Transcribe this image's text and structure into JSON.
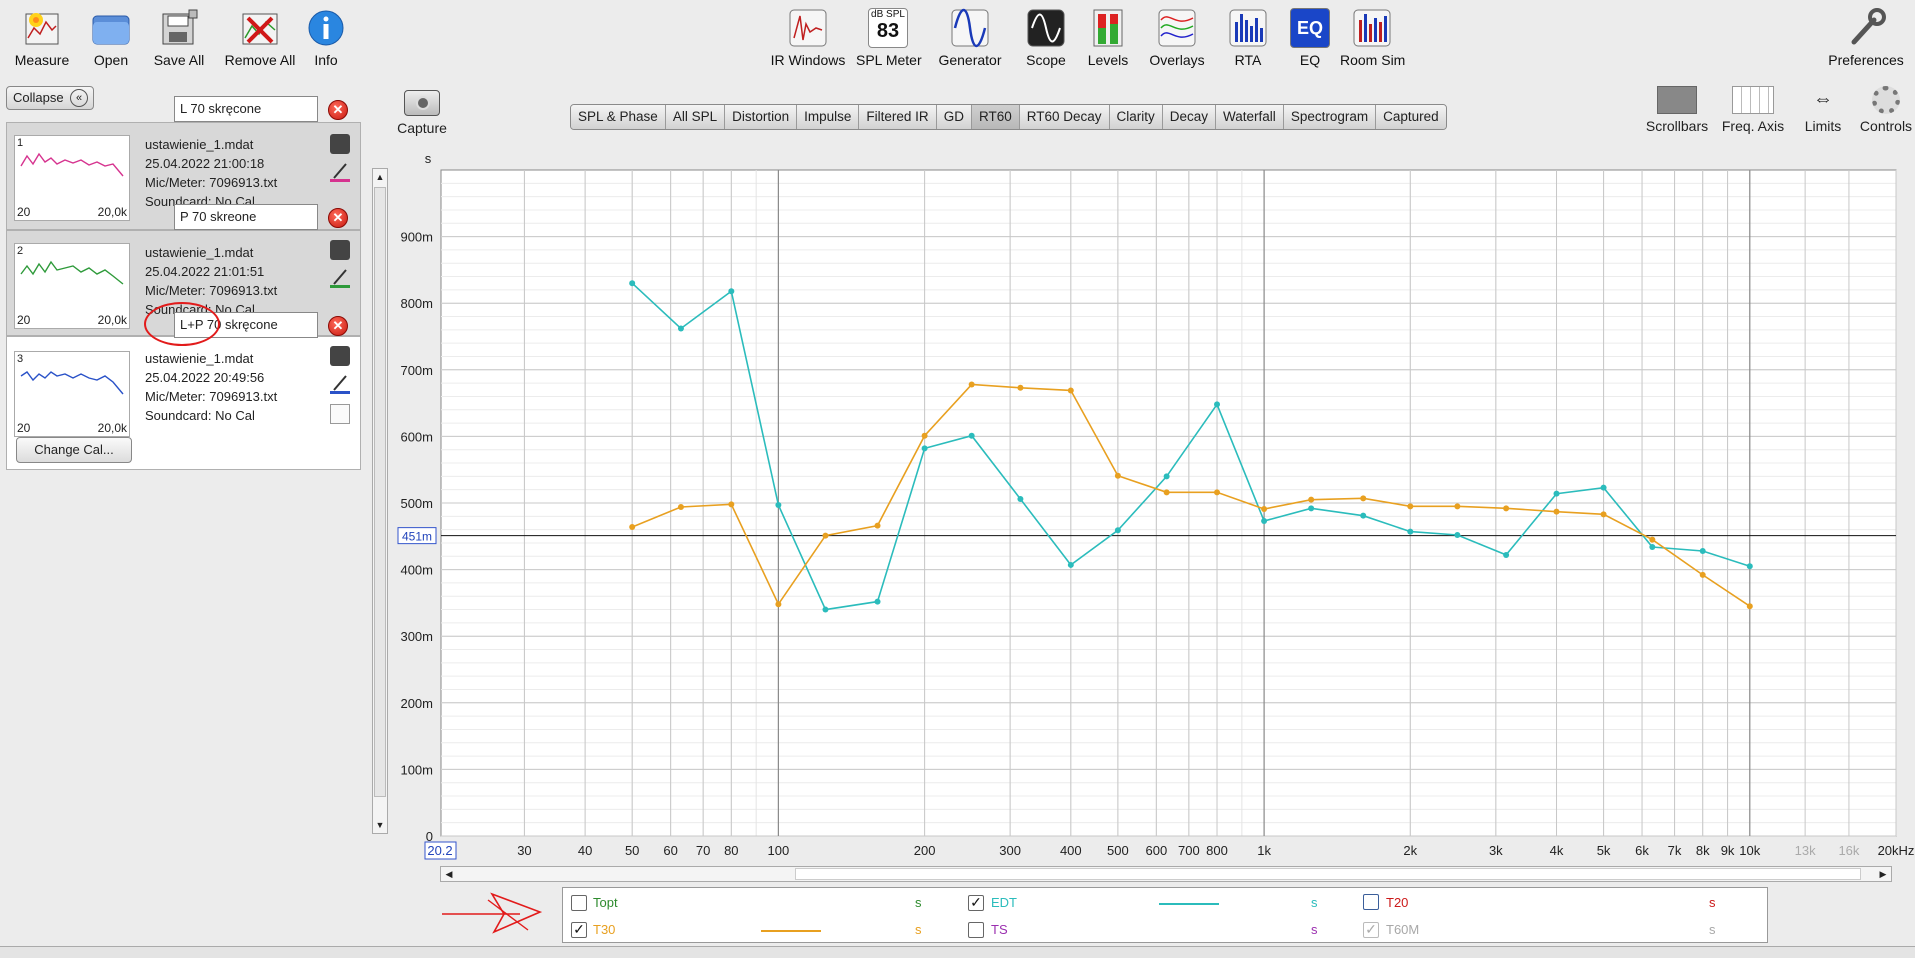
{
  "toolbar_left": [
    {
      "label": "Measure",
      "icon": "measure-icon"
    },
    {
      "label": "Open",
      "icon": "open-folder-icon"
    },
    {
      "label": "Save All",
      "icon": "save-all-icon"
    },
    {
      "label": "Remove All",
      "icon": "remove-all-icon"
    },
    {
      "label": "Info",
      "icon": "info-icon"
    }
  ],
  "toolbar_center": [
    {
      "label": "IR Windows",
      "icon": "ir-windows-icon"
    },
    {
      "label": "SPL Meter",
      "icon": "spl-meter-icon"
    },
    {
      "label": "Generator",
      "icon": "generator-icon"
    },
    {
      "label": "Scope",
      "icon": "scope-icon"
    },
    {
      "label": "Levels",
      "icon": "levels-icon"
    },
    {
      "label": "Overlays",
      "icon": "overlays-icon"
    },
    {
      "label": "RTA",
      "icon": "rta-icon"
    },
    {
      "label": "EQ",
      "icon": "eq-icon"
    },
    {
      "label": "Room Sim",
      "icon": "room-sim-icon"
    }
  ],
  "spl_meter": {
    "unit": "dB SPL",
    "value": "83"
  },
  "eq_icon_text": "EQ",
  "preferences_label": "Preferences",
  "collapse_label": "Collapse",
  "capture_label": "Capture",
  "tabs": [
    "SPL & Phase",
    "All SPL",
    "Distortion",
    "Impulse",
    "Filtered IR",
    "GD",
    "RT60",
    "RT60 Decay",
    "Clarity",
    "Decay",
    "Waterfall",
    "Spectrogram",
    "Captured"
  ],
  "active_tab": "RT60",
  "right_controls": [
    "Scrollbars",
    "Freq. Axis",
    "Limits",
    "Controls"
  ],
  "measurements": [
    {
      "num": "1",
      "name": "L 70 skręcone",
      "file": "ustawienie_1.mdat",
      "date": "25.04.2022 21:00:18",
      "mic": "Mic/Meter: 7096913.txt",
      "soundcard": "Soundcard: No Cal",
      "color": "#d6338f",
      "lo": "20",
      "hi": "20,0k"
    },
    {
      "num": "2",
      "name": "P 70 skreone",
      "file": "ustawienie_1.mdat",
      "date": "25.04.2022 21:01:51",
      "mic": "Mic/Meter: 7096913.txt",
      "soundcard": "Soundcard: No Cal",
      "color": "#2e9a3a",
      "lo": "20",
      "hi": "20,0k"
    },
    {
      "num": "3",
      "name": "L+P 70 skręcone",
      "file": "ustawienie_1.mdat",
      "date": "25.04.2022 20:49:56",
      "mic": "Mic/Meter: 7096913.txt",
      "soundcard": "Soundcard: No Cal",
      "color": "#2a52c8",
      "lo": "20",
      "hi": "20,0k"
    }
  ],
  "change_cal_label": "Change Cal...",
  "chart_data": {
    "type": "line",
    "ylabel": "s",
    "y_unit": "s",
    "ylim": [
      0,
      1.0
    ],
    "y_ticks": [
      {
        "v": 0,
        "label": "0"
      },
      {
        "v": 0.1,
        "label": "100m"
      },
      {
        "v": 0.2,
        "label": "200m"
      },
      {
        "v": 0.3,
        "label": "300m"
      },
      {
        "v": 0.4,
        "label": "400m"
      },
      {
        "v": 0.5,
        "label": "500m"
      },
      {
        "v": 0.6,
        "label": "600m"
      },
      {
        "v": 0.7,
        "label": "700m"
      },
      {
        "v": 0.8,
        "label": "800m"
      },
      {
        "v": 0.9,
        "label": "900m"
      }
    ],
    "x_scale": "log",
    "xlim": [
      20.2,
      20000
    ],
    "x_start_label": "20.2",
    "x_ticks": [
      {
        "v": 30,
        "label": "30"
      },
      {
        "v": 40,
        "label": "40"
      },
      {
        "v": 50,
        "label": "50"
      },
      {
        "v": 60,
        "label": "60"
      },
      {
        "v": 70,
        "label": "70"
      },
      {
        "v": 80,
        "label": "80"
      },
      {
        "v": 100,
        "label": "100"
      },
      {
        "v": 200,
        "label": "200"
      },
      {
        "v": 300,
        "label": "300"
      },
      {
        "v": 400,
        "label": "400"
      },
      {
        "v": 500,
        "label": "500"
      },
      {
        "v": 600,
        "label": "600"
      },
      {
        "v": 700,
        "label": "700"
      },
      {
        "v": 800,
        "label": "800"
      },
      {
        "v": 1000,
        "label": "1k"
      },
      {
        "v": 2000,
        "label": "2k"
      },
      {
        "v": 3000,
        "label": "3k"
      },
      {
        "v": 4000,
        "label": "4k"
      },
      {
        "v": 5000,
        "label": "5k"
      },
      {
        "v": 6000,
        "label": "6k"
      },
      {
        "v": 7000,
        "label": "7k"
      },
      {
        "v": 8000,
        "label": "8k"
      },
      {
        "v": 9000,
        "label": "9k"
      },
      {
        "v": 10000,
        "label": "10k"
      },
      {
        "v": 13000,
        "label": "13k",
        "dim": true
      },
      {
        "v": 16000,
        "label": "16k",
        "dim": true
      },
      {
        "v": 20000,
        "label": "20kHz"
      }
    ],
    "cursor": {
      "y": 0.451,
      "label": "451m"
    },
    "series": [
      {
        "name": "EDT",
        "color": "#2bbcbc",
        "x": [
          50,
          63,
          80,
          100,
          125,
          160,
          200,
          250,
          315,
          400,
          500,
          630,
          800,
          1000,
          1250,
          1600,
          2000,
          2500,
          3150,
          4000,
          5000,
          6300,
          8000,
          10000
        ],
        "y": [
          0.83,
          0.762,
          0.818,
          0.497,
          0.34,
          0.352,
          0.582,
          0.601,
          0.506,
          0.407,
          0.459,
          0.54,
          0.648,
          0.473,
          0.492,
          0.481,
          0.457,
          0.452,
          0.422,
          0.514,
          0.523,
          0.434,
          0.428,
          0.405
        ]
      },
      {
        "name": "T30",
        "color": "#e8a020",
        "x": [
          50,
          63,
          80,
          100,
          125,
          160,
          200,
          250,
          315,
          400,
          500,
          630,
          800,
          1000,
          1250,
          1600,
          2000,
          2500,
          3150,
          4000,
          5000,
          6300,
          8000,
          10000
        ],
        "y": [
          0.464,
          0.494,
          0.498,
          0.348,
          0.451,
          0.466,
          0.601,
          0.678,
          0.673,
          0.669,
          0.541,
          0.516,
          0.516,
          0.491,
          0.505,
          0.507,
          0.495,
          0.495,
          0.492,
          0.487,
          0.483,
          0.445,
          0.392,
          0.345
        ]
      }
    ]
  },
  "legend": {
    "rows": [
      [
        {
          "label": "Topt",
          "checked": false,
          "color": "#2e8b2e",
          "unit": "s"
        },
        {
          "label": "EDT",
          "checked": true,
          "color": "#2bbcbc",
          "unit": "s",
          "line": true
        },
        {
          "label": "T20",
          "checked": false,
          "color": "#cc1a1a",
          "unit": "s",
          "boxcolor": "#3b5e9a"
        }
      ],
      [
        {
          "label": "T30",
          "checked": true,
          "color": "#e8a020",
          "unit": "s",
          "line": true
        },
        {
          "label": "TS",
          "checked": false,
          "color": "#9b2fb0",
          "unit": "s"
        },
        {
          "label": "T60M",
          "checked": true,
          "color": "#a8a8a8",
          "unit": "s",
          "disabled": true
        }
      ]
    ]
  }
}
